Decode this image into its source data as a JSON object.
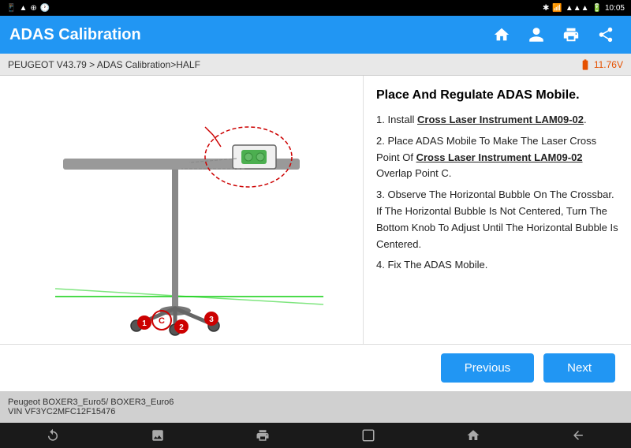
{
  "statusBar": {
    "time": "10:05",
    "icons": [
      "bluetooth",
      "wifi",
      "signal",
      "battery"
    ]
  },
  "header": {
    "title": "ADAS Calibration",
    "icons": [
      "home",
      "user",
      "print",
      "export"
    ]
  },
  "breadcrumb": {
    "text": "PEUGEOT V43.79 > ADAS Calibration>HALF",
    "battery": "11.76V"
  },
  "instructions": {
    "title": "Place And Regulate ADAS Mobile.",
    "steps": [
      "1. Install Cross Laser Instrument LAM09-02.",
      "2. Place ADAS Mobile To Make The Laser Cross Point Of Cross Laser Instrument LAM09-02 Overlap Point C.",
      "3. Observe The Horizontal Bubble On The Crossbar. If The Horizontal Bubble Is Not Centered, Turn The Bottom Knob To Adjust Until The Horizontal Bubble Is Centered.",
      "4. Fix The ADAS Mobile."
    ]
  },
  "navigation": {
    "previous_label": "Previous",
    "next_label": "Next"
  },
  "footer": {
    "line1": "Peugeot BOXER3_Euro5/ BOXER3_Euro6",
    "line2": "VIN VF3YC2MFC12F15476"
  },
  "androidNav": {
    "back": "↺",
    "photo": "🖼",
    "print": "🖨",
    "square": "□",
    "home": "⌂",
    "recent": "↩"
  }
}
